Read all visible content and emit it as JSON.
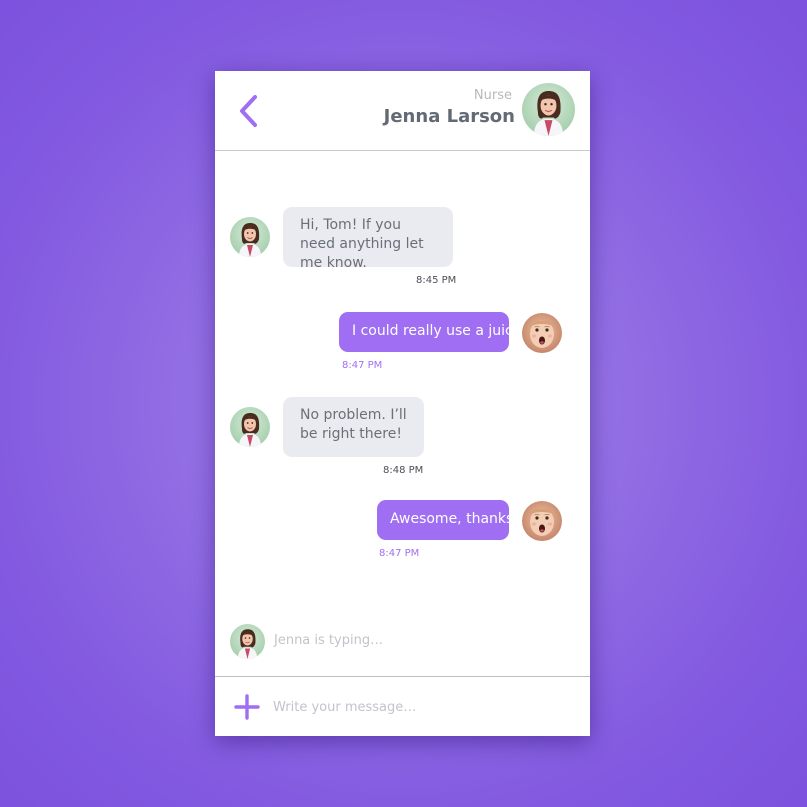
{
  "header": {
    "back_icon": "chevron-left-icon",
    "contact_role": "Nurse",
    "contact_name": "Jenna Larson",
    "avatar_icon": "nurse-avatar"
  },
  "messages": [
    {
      "direction": "in",
      "text": "Hi, Tom! If you need anything let me know.",
      "time": "8:45 PM"
    },
    {
      "direction": "out",
      "text": "I could really use a juice!",
      "time": "8:47 PM"
    },
    {
      "direction": "in",
      "text": "No problem. I’ll be right there!",
      "time": "8:48 PM"
    },
    {
      "direction": "out",
      "text": "Awesome, thanks",
      "time": "8:47 PM"
    }
  ],
  "typing_indicator": "Jenna is typing…",
  "composer": {
    "add_icon": "plus-icon",
    "placeholder": "Write your message…",
    "value": ""
  },
  "colors": {
    "accent": "#9f6ef2",
    "background": "#8259e0",
    "incoming_bubble": "#e9ebf1",
    "name_text": "#636a74"
  }
}
